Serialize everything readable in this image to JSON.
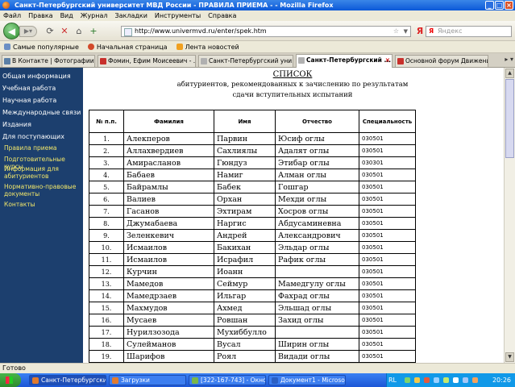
{
  "window": {
    "title": "Санкт-Петербургский университет МВД России - ПРАВИЛА ПРИЕМА - - Mozilla Firefox"
  },
  "menu": [
    "Файл",
    "Правка",
    "Вид",
    "Журнал",
    "Закладки",
    "Инструменты",
    "Справка"
  ],
  "nav": {
    "url": "http://www.univermvd.ru/enter/spek.htm",
    "search_placeholder": "Яндекс",
    "search_engine_glyph": "Я"
  },
  "bookmarks": [
    "Самые популярные",
    "Начальная страница",
    "Лента новостей"
  ],
  "tabs": [
    {
      "label": "В Контакте | Фотографии",
      "color": "#5b7fa6"
    },
    {
      "label": "Фомин, Ефим Моисеевич - ...",
      "color": "#c8302c"
    },
    {
      "label": "Санкт-Петербургский уни...",
      "color": "#b0b0b0"
    },
    {
      "label": "Санкт-Петербургский ...",
      "color": "#b0b0b0",
      "active": true
    },
    {
      "label": "Основной форум Движени...",
      "color": "#c8302c"
    }
  ],
  "sidebar": {
    "items": [
      "Общая информация",
      "Учебная работа",
      "Научная работа",
      "Международные связи",
      "Издания",
      "Для поступающих"
    ],
    "subitems": [
      "Правила приема",
      "Подготовительные курсы",
      "Информация для абитуриентов",
      "Нормативно-правовые документы",
      "Контакты"
    ]
  },
  "document": {
    "heading": "СПИСОК",
    "subheading_1": "абитуриентов, рекомендованных к зачислению по результатам",
    "subheading_2": "сдачи вступительных испытаний"
  },
  "table": {
    "headers": [
      "№ п.п.",
      "Фамилия",
      "Имя",
      "Отчество",
      "Специальность"
    ],
    "rows": [
      [
        "1.",
        "Алекперов",
        "Парвин",
        "Юсиф оглы",
        "030501"
      ],
      [
        "2.",
        "Аллахвердиев",
        "Сахлиялы",
        "Адалят оглы",
        "030501"
      ],
      [
        "3.",
        "Амирасланов",
        "Гюндуз",
        "Этибар оглы",
        "030301"
      ],
      [
        "4.",
        "Бабаев",
        "Намиг",
        "Алман оглы",
        "030501"
      ],
      [
        "5.",
        "Байрамлы",
        "Бабек",
        "Гошгар",
        "030501"
      ],
      [
        "6.",
        "Валиев",
        "Орхан",
        "Мехди оглы",
        "030501"
      ],
      [
        "7.",
        "Гасанов",
        "Эхтирам",
        "Хосров оглы",
        "030501"
      ],
      [
        "8.",
        "Джумабаева",
        "Наргис",
        "Абдусаминевна",
        "030501"
      ],
      [
        "9.",
        "Зеленкевич",
        "Андрей",
        "Александрович",
        "030501"
      ],
      [
        "10.",
        "Исмаилов",
        "Бакихан",
        "Эльдар оглы",
        "030501"
      ],
      [
        "11.",
        "Исмаилов",
        "Исрафил",
        "Рафик оглы",
        "030501"
      ],
      [
        "12.",
        "Курчин",
        "Иоанн",
        "",
        "030501"
      ],
      [
        "13.",
        "Мамедов",
        "Сеймур",
        "Мамедгулу оглы",
        "030501"
      ],
      [
        "14.",
        "Мамедрзаев",
        "Ильгар",
        "Фахрад оглы",
        "030501"
      ],
      [
        "15.",
        "Махмудов",
        "Ахмед",
        "Эльшад оглы",
        "030501"
      ],
      [
        "16.",
        "Мусаев",
        "Ровшан",
        "Захид оглы",
        "030501"
      ],
      [
        "17.",
        "Нурилзозода",
        "Мухиббулло",
        "",
        "030501"
      ],
      [
        "18.",
        "Сулейманов",
        "Вусал",
        "Ширин оглы",
        "030501"
      ],
      [
        "19.",
        "Шарифов",
        "Роял",
        "Видади оглы",
        "030501"
      ]
    ]
  },
  "status": {
    "text": "Готово"
  },
  "taskbar": {
    "tasks": [
      {
        "label": "Санкт-Петербургски...",
        "color": "#e07a2e",
        "pressed": true
      },
      {
        "label": "Загрузки",
        "color": "#e07a2e"
      },
      {
        "label": "[322-167-743] - Окно...",
        "color": "#7ab648"
      },
      {
        "label": "Документ1 - Microso...",
        "color": "#2b5fc4"
      }
    ],
    "lang": "RL",
    "clock": "20:26"
  }
}
